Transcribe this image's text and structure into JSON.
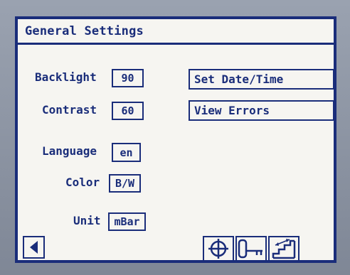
{
  "window": {
    "title": "General Settings"
  },
  "settings": {
    "backlight": {
      "label": "Backlight",
      "value": "90"
    },
    "contrast": {
      "label": "Contrast",
      "value": "60"
    },
    "language": {
      "label": "Language",
      "value": "en"
    },
    "color": {
      "label": "Color",
      "value": "B/W"
    },
    "unit": {
      "label": "Unit",
      "value": "mBar"
    }
  },
  "actions": {
    "set_datetime": "Set Date/Time",
    "view_errors": "View Errors"
  },
  "toolbar": {
    "icons": [
      "back-arrow-icon",
      "crosshair-icon",
      "key-icon",
      "stairs-icon"
    ]
  },
  "colors": {
    "accent": "#1a2d7a",
    "screen_bg": "#f6f5f1"
  }
}
